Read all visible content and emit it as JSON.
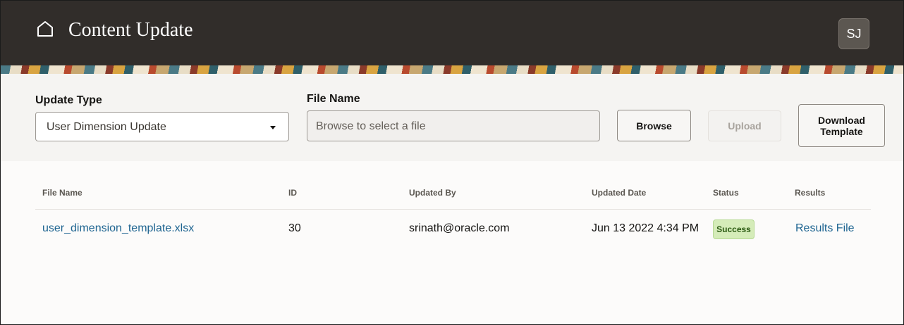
{
  "header": {
    "title": "Content Update",
    "avatar_initials": "SJ",
    "home_icon": "home-icon"
  },
  "form": {
    "update_type_label": "Update Type",
    "update_type_value": "User Dimension Update",
    "file_name_label": "File Name",
    "file_name_placeholder": "Browse to select a file",
    "browse_label": "Browse",
    "upload_label": "Upload",
    "download_template_label": "Download Template"
  },
  "table": {
    "columns": [
      "File Name",
      "ID",
      "Updated By",
      "Updated Date",
      "Status",
      "Results"
    ],
    "rows": [
      {
        "file_name": "user_dimension_template.xlsx",
        "id": "30",
        "updated_by": "srinath@oracle.com",
        "updated_date": "Jun 13 2022 4:34 PM",
        "status": "Success",
        "results": "Results File"
      }
    ]
  },
  "colors": {
    "header_bg": "#312d2a",
    "link": "#1f6591",
    "success_bg": "#d5ecb9",
    "success_text": "#2b5a12"
  }
}
